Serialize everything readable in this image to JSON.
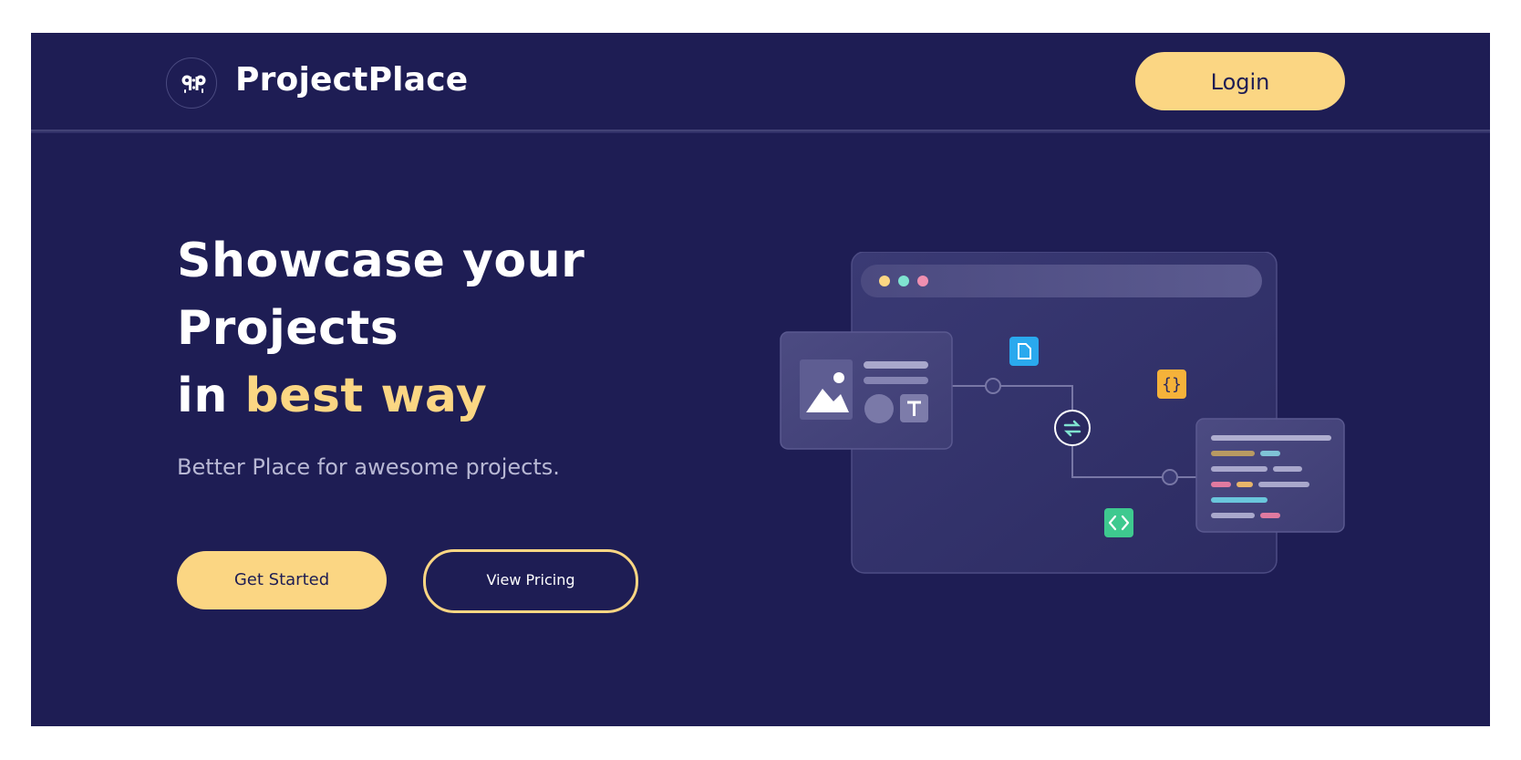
{
  "header": {
    "logo_glyph": "ᑫ:ᑭ",
    "brand": "ProjectPlace",
    "login_label": "Login"
  },
  "hero": {
    "line1": "Showcase your",
    "line2": "Projects",
    "line3_prefix": "in",
    "line3_accent": "best way",
    "subtitle": "Better Place for awesome projects.",
    "cta_primary": "Get Started",
    "cta_secondary": "View Pricing"
  },
  "colors": {
    "background": "#1e1d54",
    "accent": "#fbd683",
    "text": "#ffffff",
    "muted": "#b8b8d4"
  },
  "illustration": {
    "icons": [
      "window-dots-icon",
      "image-icon",
      "text-icon",
      "file-icon",
      "braces-icon",
      "sync-icon",
      "code-icon"
    ]
  }
}
